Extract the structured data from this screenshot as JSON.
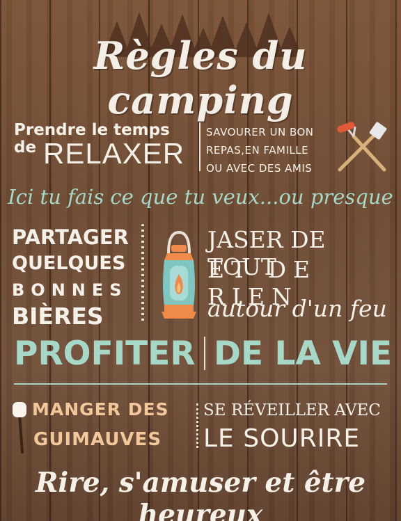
{
  "title": "Règles du camping",
  "relax": {
    "line1": "Prendre le temps",
    "line2_small": "de",
    "line2_big": "RELAXER"
  },
  "meal": {
    "line1": "SAVOURER UN BON",
    "line2": "REPAS,EN FAMILLE",
    "line3": "OU AVEC DES AMIS"
  },
  "script_line": "Ici tu fais ce que tu veux...ou presque",
  "beer": {
    "line1": "PARTAGER",
    "line2": "QUELQUES",
    "line3": "BONNES",
    "line4": "BIÈRES"
  },
  "chat": {
    "line1": "JASER DE TOUT",
    "line2": "ET DE RIEN",
    "line3": "autour d'un feu"
  },
  "life": {
    "left": "PROFITER",
    "right": "DE LA VIE"
  },
  "marshmallows": {
    "line1": "MANGER DES",
    "line2": "GUIMAUVES"
  },
  "wake": {
    "line1": "SE RÉVEILLER AVEC",
    "line2": "LE SOURIRE"
  },
  "footer": "Rire, s'amuser et être heureux",
  "colors": {
    "wood": "#6d4a32",
    "cream": "#f6f1e8",
    "mint": "#a6d8c8",
    "peach": "#f2c79a",
    "lantern_teal": "#7fc6c0",
    "flame": "#f08a4b"
  },
  "icons": [
    "pine-trees-icon",
    "bbq-tools-icon",
    "lantern-icon",
    "marshmallow-stick-icon"
  ]
}
